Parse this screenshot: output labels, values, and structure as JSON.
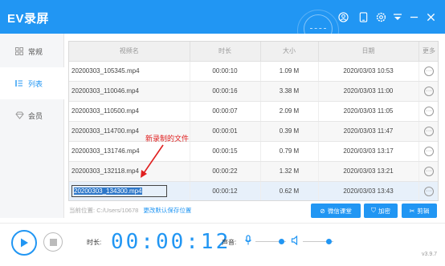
{
  "app": {
    "title": "EV录屏",
    "version": "v3.9.7"
  },
  "titlebar_icons": [
    "user-icon",
    "phone-icon",
    "settings-icon",
    "dropdown-icon",
    "minimize-icon",
    "close-icon"
  ],
  "sidebar": {
    "items": [
      {
        "label": "常规",
        "icon": "grid-icon",
        "active": false
      },
      {
        "label": "列表",
        "icon": "list-icon",
        "active": true
      },
      {
        "label": "会员",
        "icon": "diamond-icon",
        "active": false
      }
    ]
  },
  "table": {
    "headers": [
      "视频名",
      "时长",
      "大小",
      "日期",
      "更多"
    ],
    "rows": [
      {
        "name": "20200303_105345.mp4",
        "duration": "00:00:10",
        "size": "1.09 M",
        "date": "2020/03/03 10:53"
      },
      {
        "name": "20200303_110046.mp4",
        "duration": "00:00:16",
        "size": "3.38 M",
        "date": "2020/03/03 11:00"
      },
      {
        "name": "20200303_110500.mp4",
        "duration": "00:00:07",
        "size": "2.09 M",
        "date": "2020/03/03 11:05"
      },
      {
        "name": "20200303_114700.mp4",
        "duration": "00:00:01",
        "size": "0.39 M",
        "date": "2020/03/03 11:47"
      },
      {
        "name": "20200303_131746.mp4",
        "duration": "00:00:15",
        "size": "0.79 M",
        "date": "2020/03/03 13:17"
      },
      {
        "name": "20200303_132118.mp4",
        "duration": "00:00:22",
        "size": "1.32 M",
        "date": "2020/03/03 13:21"
      },
      {
        "name": "20200303_134300.mp4",
        "duration": "00:00:12",
        "size": "0.62 M",
        "date": "2020/03/03 13:43"
      }
    ],
    "more_glyph": "···"
  },
  "annotation": {
    "text": "新录制的文件",
    "color": "#e02020"
  },
  "footer": {
    "path_label": "当前位置:",
    "path_value": "C:/Users/10678",
    "change_link": "更改默认保存位置",
    "buttons": {
      "wechat": "微信课堂",
      "encrypt": "加密",
      "cut": "剪辑"
    }
  },
  "bottom": {
    "duration_label": "时长:",
    "timer": "00:00:12",
    "sound_label": "声音:"
  },
  "colors": {
    "accent": "#2196f3",
    "annotation": "#e02020"
  }
}
